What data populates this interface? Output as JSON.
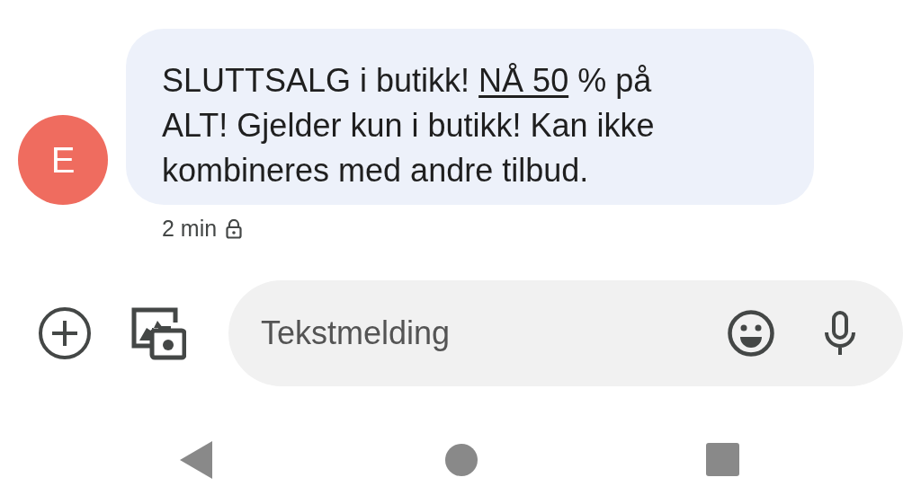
{
  "message": {
    "avatar": "E",
    "parts": [
      {
        "kind": "text",
        "text": "SLUTTSALG i butikk! "
      },
      {
        "kind": "link",
        "text": "NÅ 50"
      },
      {
        "kind": "text",
        "text": " % på ALT! Gjelder kun i butikk! Kan ikke kombineres med andre tilbud."
      }
    ],
    "time": "2 min",
    "encrypted": true
  },
  "composer": {
    "placeholder": "Tekstmelding"
  }
}
